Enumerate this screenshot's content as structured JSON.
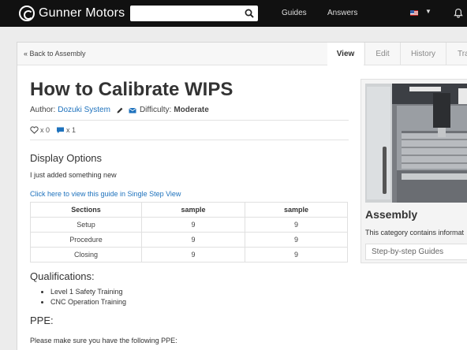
{
  "header": {
    "brand": "Gunner Motors",
    "search": {
      "value": "",
      "placeholder": ""
    },
    "nav": {
      "guides": "Guides",
      "answers": "Answers"
    },
    "flag_icon": "us-flag-icon",
    "chevron_icon": "chevron-down-icon",
    "bell_icon": "bell-icon",
    "colors": {
      "bar": "#111111"
    }
  },
  "tabs": {
    "back": "« Back to Assembly",
    "items": [
      "View",
      "Edit",
      "History",
      "Tra"
    ]
  },
  "guide": {
    "title": "How to Calibrate WIPS",
    "author_label": "Author:",
    "author": "Dozuki System",
    "difficulty_label": "Difficulty:",
    "difficulty": "Moderate",
    "likes": "x 0",
    "comments": "x 1",
    "display_heading": "Display Options",
    "note": "I just added something new",
    "single_step_link": "Click here to view this guide in Single Step View",
    "table": {
      "headers": [
        "Sections",
        "sample",
        "sample"
      ],
      "rows": [
        [
          "Setup",
          "9",
          "9"
        ],
        [
          "Procedure",
          "9",
          "9"
        ],
        [
          "Closing",
          "9",
          "9"
        ]
      ]
    },
    "qualifications_heading": "Qualifications:",
    "qualifications": [
      "Level 1 Safety Training",
      "CNC Operation Training"
    ],
    "ppe_heading": "PPE:",
    "ppe_note": "Please make sure you have the following PPE:"
  },
  "sidebar": {
    "title": "Assembly",
    "description": "This category contains informat",
    "button": "Step-by-step Guides"
  },
  "colors": {
    "link": "#1e72bd",
    "accent_icon": "#1e72bd"
  }
}
